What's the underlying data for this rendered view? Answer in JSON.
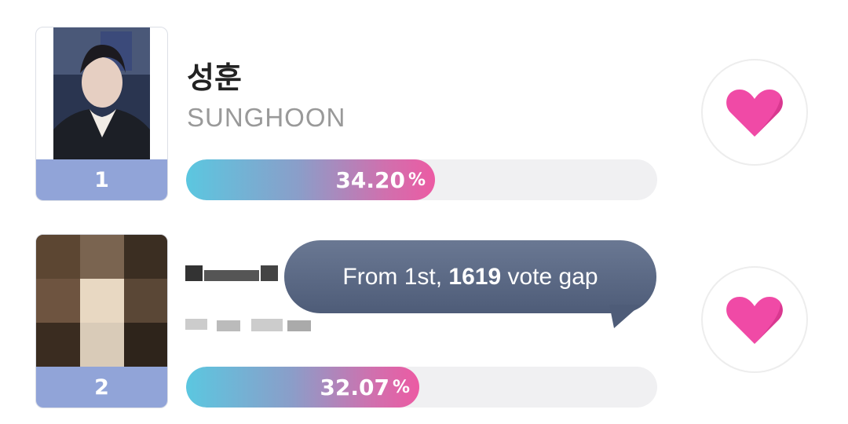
{
  "colors": {
    "rank_bg": "#91a4d8",
    "bar_track": "#f0f0f2",
    "heart": "#f04aa6",
    "tooltip_bg": "#5a6884"
  },
  "candidates": [
    {
      "rank": "1",
      "name_korean": "성훈",
      "name_english": "SUNGHOON",
      "percent": "34.20",
      "unit": "%",
      "share": 34.2,
      "photo": "member-photo",
      "vote_icon": "heart-icon"
    },
    {
      "rank": "2",
      "name_korean": "",
      "name_english": "",
      "percent": "32.07",
      "unit": "%",
      "share": 32.07,
      "photo": "pixelated-photo",
      "vote_icon": "heart-icon"
    }
  ],
  "tooltip": {
    "prefix": "From 1st,",
    "gap": "1619",
    "suffix": "vote gap"
  }
}
